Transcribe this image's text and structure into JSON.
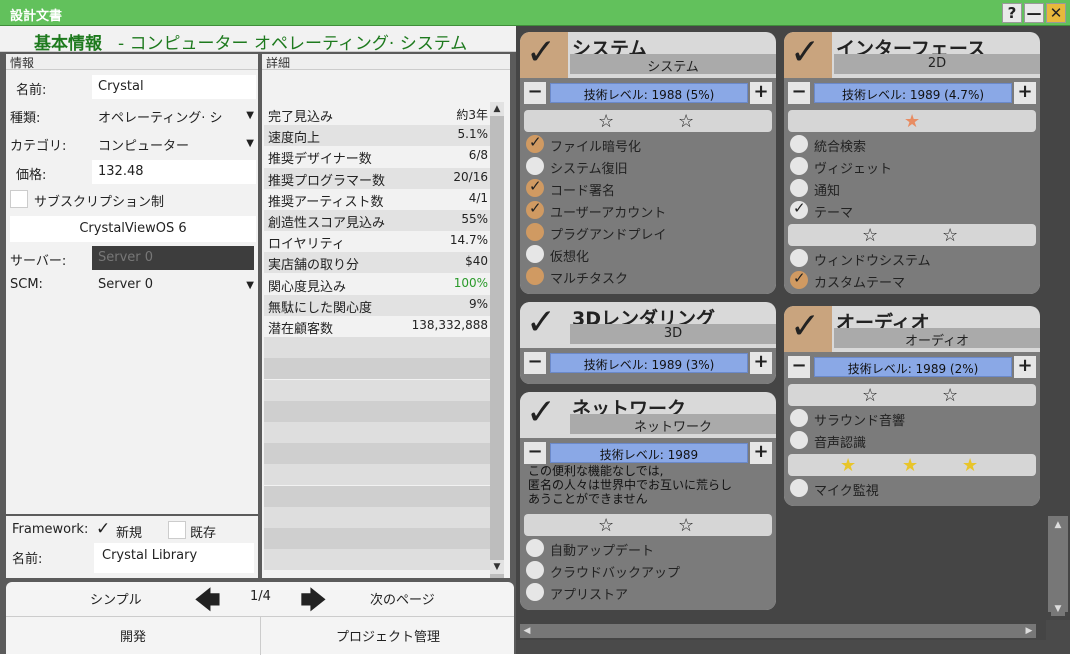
{
  "window": {
    "title": "設計文書",
    "help": "?",
    "minimize": "—",
    "close": "✕"
  },
  "header": {
    "title": "基本情報",
    "subtitle": "- コンピューター オペレーティング· システム"
  },
  "info": {
    "section": "情報",
    "name_label": "名前:",
    "name_value": "Crystal",
    "type_label": "種類:",
    "type_value": "オペレーティング· シ",
    "cat_label": "カテゴリ:",
    "cat_value": "コンピューター",
    "price_label": "価格:",
    "price_value": "132.48",
    "subscription_label": "サブスクリプション制",
    "product": "CrystalViewOS 6",
    "server_label": "サーバー:",
    "server_value": "Server 0",
    "scm_label": "SCM:",
    "scm_value": "Server 0"
  },
  "framework": {
    "label": "Framework:",
    "new_label": "新規",
    "existing_label": "既存",
    "name_label": "名前:",
    "name_value": "Crystal Library"
  },
  "details": {
    "section": "詳細",
    "rows": [
      {
        "k": "完了見込み",
        "v": "約3年"
      },
      {
        "k": "速度向上",
        "v": "5.1%"
      },
      {
        "k": "推奨デザイナー数",
        "v": "6/8"
      },
      {
        "k": "推奨プログラマー数",
        "v": "20/16"
      },
      {
        "k": "推奨アーティスト数",
        "v": "4/1"
      },
      {
        "k": "創造性スコア見込み",
        "v": "55%"
      },
      {
        "k": "ロイヤリティ",
        "v": "14.7%"
      },
      {
        "k": "実店舗の取り分",
        "v": "$40"
      },
      {
        "k": "関心度見込み",
        "v": "100%"
      },
      {
        "k": "無駄にした関心度",
        "v": "9%"
      },
      {
        "k": "潜在顧客数",
        "v": "138,332,888"
      }
    ]
  },
  "nav": {
    "simple": "シンプル",
    "page": "1/4",
    "next": "次のページ",
    "develop": "開発",
    "project": "プロジェクト管理"
  },
  "colors": {
    "accent": "#62c15c",
    "header_text": "#1e7a1e",
    "checkbox_on": "#d09a62",
    "level_bar": "#8aa8e6",
    "interest_green": "#2a9a2a"
  },
  "features": {
    "system": {
      "name": "システム",
      "sub": "システム",
      "level": "技術レベル: 1988 (5%)",
      "opts": [
        "ファイル暗号化",
        "システム復旧",
        "コード署名",
        "ユーザーアカウント",
        "プラグアンドプレイ",
        "仮想化",
        "マルチタスク"
      ]
    },
    "interface": {
      "name": "インターフェース",
      "sub": "2D",
      "level": "技術レベル: 1989 (4.7%)",
      "opts": [
        "統合検索",
        "ヴィジェット",
        "通知",
        "テーマ",
        "ウィンドウシステム",
        "カスタムテーマ"
      ]
    },
    "render": {
      "name": "3Dレンダリング",
      "sub": "3D",
      "level": "技術レベル: 1989 (3%)"
    },
    "audio": {
      "name": "オーディオ",
      "sub": "オーディオ",
      "level": "技術レベル: 1989 (2%)",
      "opts": [
        "サラウンド音響",
        "音声認識",
        "マイク監視"
      ]
    },
    "network": {
      "name": "ネットワーク",
      "sub": "ネットワーク",
      "level": "技術レベル: 1989",
      "note": "この便利な機能なしでは,\n匿名の人々は世界中でお互いに荒らし\nあうことができません",
      "opts": [
        "自動アップデート",
        "クラウドバックアップ",
        "アプリストア"
      ]
    }
  }
}
